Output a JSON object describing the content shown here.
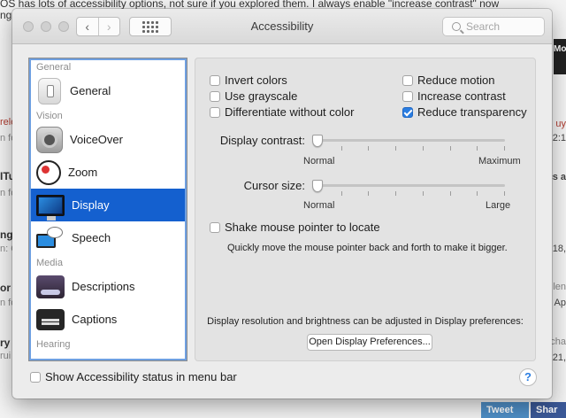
{
  "background": {
    "top_line": "OS has lots of accessibility options, not sure if you explored them. I always enable \"increase contrast\" now",
    "top_line2": "ng",
    "left_fragments": [
      "relo",
      "n fo",
      "ITu",
      "n fo",
      "ng",
      "n: O",
      "or I",
      "n fo",
      "ry",
      "rui"
    ],
    "right_fragments": [
      "uy",
      "2:1",
      "ics a",
      "18,",
      "len",
      "Ap",
      "cha",
      "21,"
    ],
    "dark_tab": "Mor",
    "twitter": "Tweet",
    "facebook": "Shar"
  },
  "window": {
    "title": "Accessibility",
    "search_placeholder": "Search",
    "nav_back": "‹",
    "nav_forward": "›"
  },
  "sidebar": {
    "sections": [
      {
        "header": "General",
        "items": [
          {
            "label": "General",
            "icon": "general-icon"
          }
        ]
      },
      {
        "header": "Vision",
        "items": [
          {
            "label": "VoiceOver",
            "icon": "voiceover-icon"
          },
          {
            "label": "Zoom",
            "icon": "zoom-icon"
          },
          {
            "label": "Display",
            "icon": "display-icon",
            "selected": true
          },
          {
            "label": "Speech",
            "icon": "speech-icon"
          }
        ]
      },
      {
        "header": "Media",
        "items": [
          {
            "label": "Descriptions",
            "icon": "descriptions-icon"
          },
          {
            "label": "Captions",
            "icon": "captions-icon"
          }
        ]
      },
      {
        "header": "Hearing",
        "items": []
      }
    ]
  },
  "display": {
    "checkboxes": {
      "invert_colors": {
        "label": "Invert colors",
        "checked": false
      },
      "use_grayscale": {
        "label": "Use grayscale",
        "checked": false
      },
      "differentiate": {
        "label": "Differentiate without color",
        "checked": false
      },
      "reduce_motion": {
        "label": "Reduce motion",
        "checked": false
      },
      "increase_contrast": {
        "label": "Increase contrast",
        "checked": false
      },
      "reduce_transparency": {
        "label": "Reduce transparency",
        "checked": true
      }
    },
    "contrast_slider": {
      "label": "Display contrast:",
      "min_label": "Normal",
      "max_label": "Maximum",
      "value": 0
    },
    "cursor_slider": {
      "label": "Cursor size:",
      "min_label": "Normal",
      "max_label": "Large",
      "value": 0
    },
    "shake": {
      "label": "Shake mouse pointer to locate",
      "checked": false,
      "description": "Quickly move the mouse pointer back and forth to make it bigger."
    },
    "info_text": "Display resolution and brightness can be adjusted in Display preferences:",
    "open_prefs_button": "Open Display Preferences..."
  },
  "footer": {
    "show_status": {
      "label": "Show Accessibility status in menu bar",
      "checked": false
    },
    "help": "?"
  },
  "colors": {
    "selection": "#1460cf",
    "checkbox_checked": "#2a7de1"
  }
}
